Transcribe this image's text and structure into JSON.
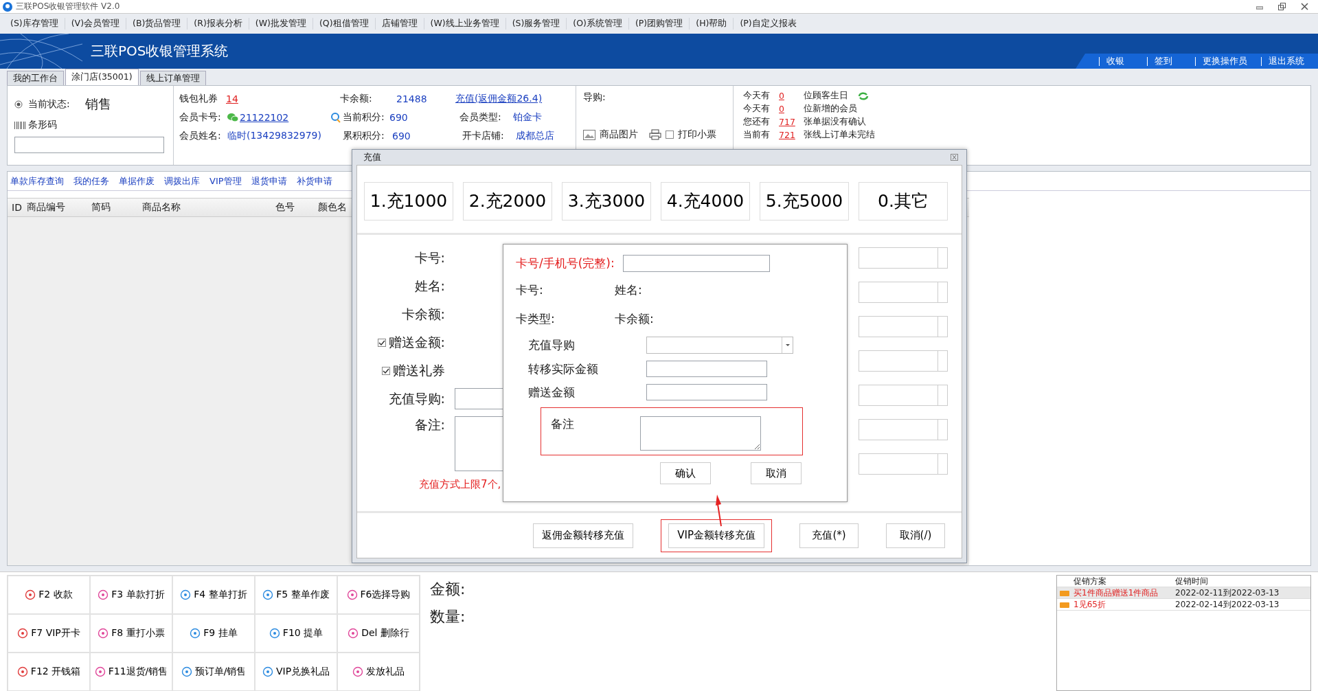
{
  "window": {
    "title": "三联POS收银管理软件 V2.0"
  },
  "menu": [
    "(S)库存管理",
    "(V)会员管理",
    "(B)货品管理",
    "(R)报表分析",
    "(W)批发管理",
    "(Q)租借管理",
    "店铺管理",
    "(W)线上业务管理",
    "(S)服务管理",
    "(O)系统管理",
    "(P)团购管理",
    "(H)帮助",
    "(P)自定义报表"
  ],
  "banner": {
    "title": "三联POS收银管理系统",
    "links": [
      "收银",
      "签到",
      "更换操作员",
      "退出系统"
    ]
  },
  "tabs": [
    {
      "label": "我的工作台",
      "selected": false
    },
    {
      "label": "涂门店(35001)",
      "selected": true
    },
    {
      "label": "线上订单管理",
      "selected": false
    }
  ],
  "status": {
    "label": "当前状态:",
    "value": "销售",
    "barcode_label": "条形码"
  },
  "member": {
    "wallet_label": "钱包礼券",
    "wallet": "14",
    "card_label": "会员卡号:",
    "card": "21122102",
    "name_label": "会员姓名:",
    "name": "临时(13429832979)",
    "balance_label": "卡余额:",
    "balance": "21488",
    "points_label": "当前积分:",
    "points": "690",
    "total_label": "累积积分:",
    "total": "690",
    "recharge_link": "充值(返佣金额26.4)",
    "type_label": "会员类型:",
    "type": "铂金卡",
    "store_label": "开卡店铺:",
    "store": "成都总店"
  },
  "guide": {
    "label": "导购:",
    "picture_label": "商品图片",
    "print_label": "打印小票",
    "print_checked": false
  },
  "notices": [
    {
      "prefix": "今天有",
      "count": "0",
      "suffix": "位顾客生日"
    },
    {
      "prefix": "今天有",
      "count": "0",
      "suffix": "位新增的会员"
    },
    {
      "prefix": "您还有",
      "count": "717",
      "suffix": "张单据没有确认"
    },
    {
      "prefix": "当前有",
      "count": "721",
      "suffix": "张线上订单未完结"
    }
  ],
  "quick_links": [
    "单款库存查询",
    "我的任务",
    "单据作废",
    "调拨出库",
    "VIP管理",
    "退货申请",
    "补货申请"
  ],
  "table": {
    "columns": [
      "ID",
      "商品编号",
      "简码",
      "商品名称",
      "色号",
      "颜色名"
    ]
  },
  "recharge_dialog": {
    "title": "充值",
    "presets": [
      "1.充1000",
      "2.充2000",
      "3.充3000",
      "4.充4000",
      "5.充5000",
      "0.其它"
    ],
    "fields": [
      {
        "label": "卡号:",
        "kind": "text"
      },
      {
        "label": "姓名:",
        "kind": "text"
      },
      {
        "label": "卡余额:",
        "kind": "text"
      },
      {
        "label": "赠送金额:",
        "kind": "checkbox",
        "checked": true
      },
      {
        "label": "赠送礼券",
        "kind": "checkbox",
        "checked": true
      },
      {
        "label": "充值导购:",
        "kind": "input"
      },
      {
        "label": "备注:",
        "kind": "textarea"
      }
    ],
    "note": "充值方式上限7个,",
    "buttons": [
      {
        "label": "返佣金额转移充值",
        "highlighted": false
      },
      {
        "label": "VIP金额转移充值",
        "highlighted": true
      },
      {
        "label": "充值(*)",
        "highlighted": false
      },
      {
        "label": "取消(/)",
        "highlighted": false
      }
    ]
  },
  "transfer_dialog": {
    "phone_label": "卡号/手机号(完整):",
    "info": [
      [
        "卡号:",
        "姓名:"
      ],
      [
        "卡类型:",
        "卡余额:"
      ]
    ],
    "fields": [
      {
        "label": "充值导购",
        "kind": "select",
        "highlighted": false
      },
      {
        "label": "转移实际金额",
        "kind": "input",
        "highlighted": false
      },
      {
        "label": "赠送金额",
        "kind": "input",
        "highlighted": false
      },
      {
        "label": "备注",
        "kind": "textarea",
        "highlighted": true
      }
    ],
    "buttons": [
      "确认",
      "取消"
    ]
  },
  "function_keys": [
    "F2 收款",
    "F3 单款打折",
    "F4 整单打折",
    "F5 整单作废",
    "F6选择导购",
    "F7 VIP开卡",
    "F8 重打小票",
    "F9 挂单",
    "F10 提单",
    "Del 删除行",
    "F12 开钱箱",
    "F11退货/销售",
    "预订单/销售",
    "VIP兑换礼品",
    "发放礼品"
  ],
  "totals": [
    "金额:",
    "数量:"
  ],
  "promotions": {
    "columns": [
      "促销方案",
      "促销时间"
    ],
    "rows": [
      {
        "name": "买1件商品赠送1件商品",
        "time": "2022-02-11到2022-03-13",
        "selected": true
      },
      {
        "name": "1见65折",
        "time": "2022-02-14到2022-03-13",
        "selected": false
      }
    ]
  }
}
